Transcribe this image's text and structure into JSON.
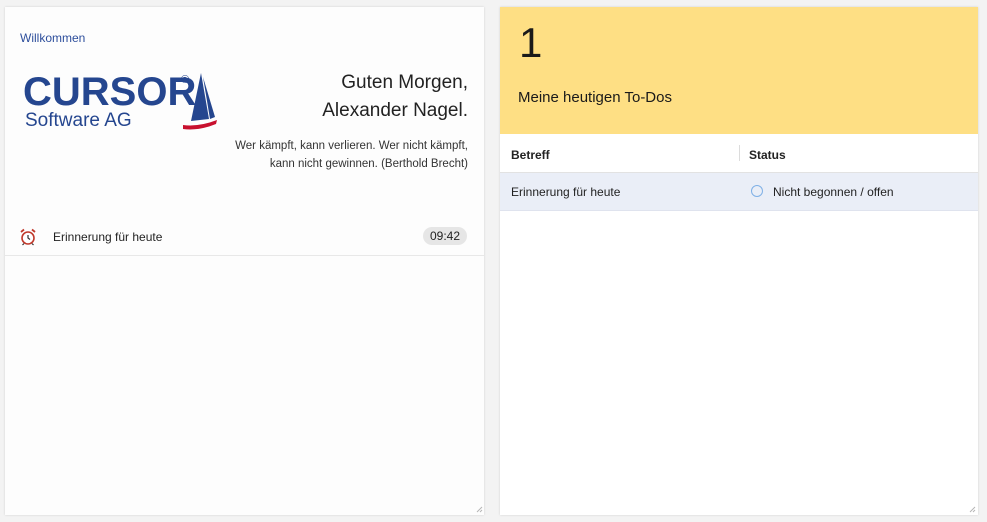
{
  "welcome": {
    "label": "Willkommen",
    "logo": {
      "name": "CURSOR",
      "registered": "®",
      "tagline": "Software AG"
    },
    "greeting_line1": "Guten Morgen,",
    "greeting_line2": "Alexander Nagel.",
    "quote_line1": "Wer kämpft, kann verlieren. Wer nicht kämpft,",
    "quote_line2": "kann nicht gewinnen. (Berthold Brecht)",
    "reminder": {
      "icon": "alarm-clock-icon",
      "text": "Erinnerung für heute",
      "time": "09:42"
    }
  },
  "todos": {
    "count": "1",
    "title": "Meine heutigen To-Dos",
    "header_color": "#fedf84",
    "columns": [
      "Betreff",
      "Status"
    ],
    "rows": [
      {
        "betreff": "Erinnerung für heute",
        "status": "Nicht begonnen / offen",
        "status_icon": "empty-circle-icon"
      }
    ]
  },
  "colors": {
    "brand_blue": "#25468f",
    "accent_red": "#c8102e",
    "row_highlight": "#eaeef7"
  }
}
